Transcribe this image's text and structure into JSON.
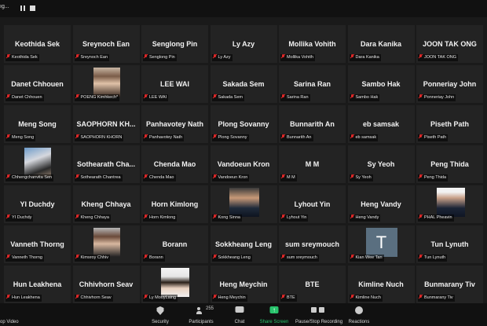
{
  "topbar": {
    "meeting_label": "ıg..."
  },
  "participants": [
    {
      "name": "Keothida Sek",
      "label": "Keothida Sek"
    },
    {
      "name": "Sreynoch Ean",
      "label": "Sreynoch Ean"
    },
    {
      "name": "Senglong Pin",
      "label": "Senglong Pin"
    },
    {
      "name": "Ly Azy",
      "label": "Ly Azy"
    },
    {
      "name": "Mollika Vohith",
      "label": "Mollika Vohith"
    },
    {
      "name": "Dara Kanika",
      "label": "Dara Kanika"
    },
    {
      "name": "JOON TAK ONG",
      "label": "JOON TAK ONG"
    },
    {
      "name": "Danet Chhouen",
      "label": "Danet Chhouen"
    },
    {
      "name": "",
      "label": "POENG Kimhkech*",
      "photo": "woman1"
    },
    {
      "name": "LEE WAI",
      "label": "LEE WAI"
    },
    {
      "name": "Sakada Sem",
      "label": "Sakada Sem"
    },
    {
      "name": "Sarina Ran",
      "label": "Sarina Ran"
    },
    {
      "name": "Sambo Hak",
      "label": "Sambo Hak"
    },
    {
      "name": "Ponneriay John",
      "label": "Ponneriay John"
    },
    {
      "name": "Meng Song",
      "label": "Meng Song"
    },
    {
      "name": "SAOPHORN KH...",
      "label": "SAOPHORN KHORN"
    },
    {
      "name": "Panhavotey Nath",
      "label": "Panhavotey Nath"
    },
    {
      "name": "Plong Sovanny",
      "label": "Plong Sovanny"
    },
    {
      "name": "Bunnarith An",
      "label": "Bunnarith An"
    },
    {
      "name": "eb samsak",
      "label": "eb samsak"
    },
    {
      "name": "Piseth Path",
      "label": "Piseth Path"
    },
    {
      "name": "",
      "label": "Chhengchanvita Sen",
      "photo": "woman2"
    },
    {
      "name": "Sothearath Cha...",
      "label": "Sothearath Chantrea"
    },
    {
      "name": "Chenda Mao",
      "label": "Chenda Mao"
    },
    {
      "name": "Vandoeun Kron",
      "label": "Vandoeun Kron"
    },
    {
      "name": "M M",
      "label": "M M"
    },
    {
      "name": "Sy Yeoh",
      "label": "Sy Yeoh"
    },
    {
      "name": "Peng Thida",
      "label": "Peng Thida"
    },
    {
      "name": "YI Duchdy",
      "label": "YI Duchdy"
    },
    {
      "name": "Kheng Chhaya",
      "label": "Kheng Chhaya"
    },
    {
      "name": "Horn Kimlong",
      "label": "Horn Kimlong"
    },
    {
      "name": "",
      "label": "Kong Sinna",
      "photo": "man1"
    },
    {
      "name": "Lyhout Yin",
      "label": "Lyhout Yin"
    },
    {
      "name": "Heng Vandy",
      "label": "Heng Vandy"
    },
    {
      "name": "",
      "label": "PHAL Pheavin",
      "photo": "man2"
    },
    {
      "name": "Vanneth Thorng",
      "label": "Vanneth Thorng"
    },
    {
      "name": "",
      "label": "Kimsroy Chhiv",
      "photo": "woman3"
    },
    {
      "name": "Borann",
      "label": "Borann"
    },
    {
      "name": "Sokkheang Leng",
      "label": "Sokkheang Leng"
    },
    {
      "name": "sum sreymouch",
      "label": "sum sreymouch"
    },
    {
      "name": "",
      "label": "Kian Wee Tan",
      "photo": "letter",
      "letter": "T"
    },
    {
      "name": "Tun Lynuth",
      "label": "Tun Lynuth"
    },
    {
      "name": "Hun Leakhena",
      "label": "Hun Leakhena"
    },
    {
      "name": "Chhivhorn Seav",
      "label": "Chhivhorn Seav"
    },
    {
      "name": "",
      "label": "Ly MouyLaing",
      "photo": "woman4"
    },
    {
      "name": "Heng Meychin",
      "label": "Heng Meychin"
    },
    {
      "name": "BTE",
      "label": "BTE"
    },
    {
      "name": "Kimline Nuch",
      "label": "Kimline Nuch"
    },
    {
      "name": "Bunmarany Tiv",
      "label": "Bunmarany Tiv"
    }
  ],
  "toolbar": {
    "video_label": "op Video",
    "security_label": "Security",
    "participants_label": "Participants",
    "participants_count": "255",
    "chat_label": "Chat",
    "share_label": "Share Screen",
    "record_label": "Pause/Stop Recording",
    "reactions_label": "Reactions"
  },
  "colors": {
    "muted_mic": "#e02828",
    "share_green": "#29c46d",
    "tile_bg": "#232323"
  }
}
